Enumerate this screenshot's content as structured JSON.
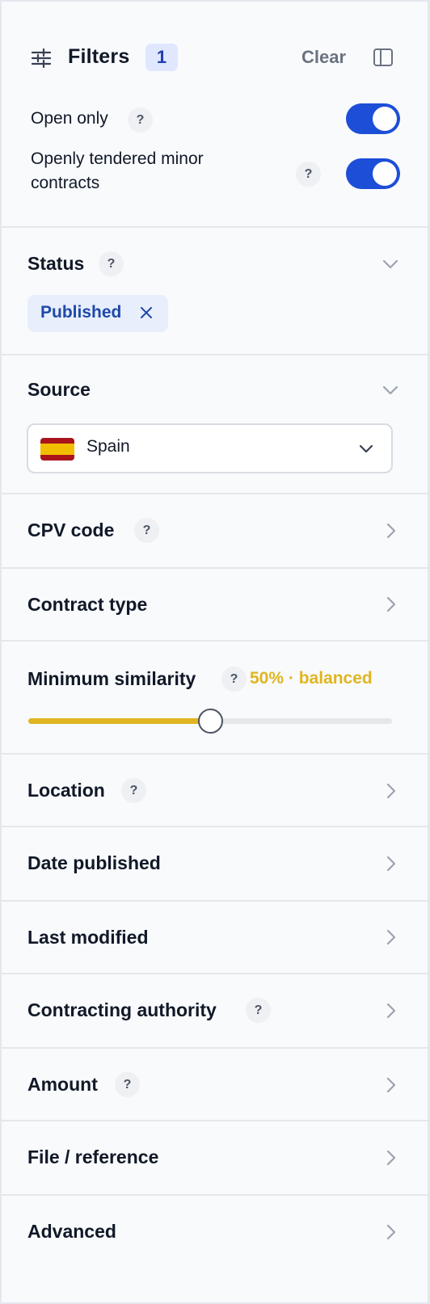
{
  "header": {
    "title": "Filters",
    "active_count": "1",
    "clear_label": "Clear",
    "icons": [
      "sliders-icon",
      "panel-toggle-icon"
    ]
  },
  "toggles": [
    {
      "label": "Open only",
      "help": "?",
      "on": true
    },
    {
      "label": "Openly tendered minor contracts",
      "help": "?",
      "on": true
    }
  ],
  "status": {
    "title": "Status",
    "help": "?",
    "expanded": true,
    "chip_label": "Published"
  },
  "source": {
    "title": "Source",
    "expanded": true,
    "selected": "Spain",
    "flag_colors": [
      "#aa151b",
      "#f1bf00",
      "#aa151b"
    ]
  },
  "cpv": {
    "title": "CPV code",
    "help": "?"
  },
  "contract_type": {
    "title": "Contract type"
  },
  "similarity": {
    "title": "Minimum similarity",
    "help": "?",
    "value_label": "50% · balanced",
    "value": 0.5,
    "accent": "#e0b520"
  },
  "location": {
    "title": "Location",
    "help": "?"
  },
  "date_published": {
    "title": "Date published"
  },
  "last_modified": {
    "title": "Last modified"
  },
  "contracting_authority": {
    "title": "Contracting authority",
    "help": "?"
  },
  "amount": {
    "title": "Amount",
    "help": "?"
  },
  "file_reference": {
    "title": "File / reference"
  },
  "advanced": {
    "title": "Advanced"
  },
  "colors": {
    "primary": "#1d4ed8",
    "accent": "#e0b520",
    "chip_bg": "#e8eefc",
    "chip_text": "#1e4aa8"
  }
}
